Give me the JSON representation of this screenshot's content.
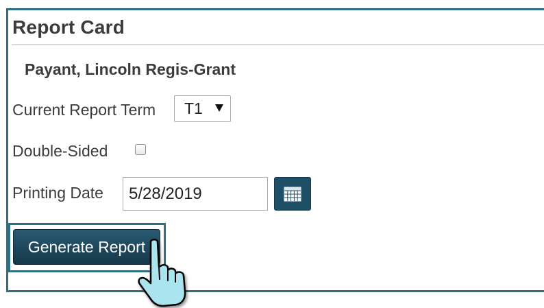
{
  "report": {
    "title": "Report Card",
    "student_name": "Payant, Lincoln Regis-Grant",
    "term": {
      "label": "Current Report Term",
      "selected": "T1"
    },
    "double_sided": {
      "label": "Double-Sided",
      "checked": false
    },
    "printing_date": {
      "label": "Printing Date",
      "value": "5/28/2019"
    },
    "calendar_icon": "calendar-icon",
    "generate_label": "Generate Report",
    "cursor_icon": "pointing-hand-cursor-icon"
  },
  "colors": {
    "accent_border": "#2e6f86",
    "button_dark": "#1f4f67",
    "cursor_fill": "#a9e4ef"
  }
}
